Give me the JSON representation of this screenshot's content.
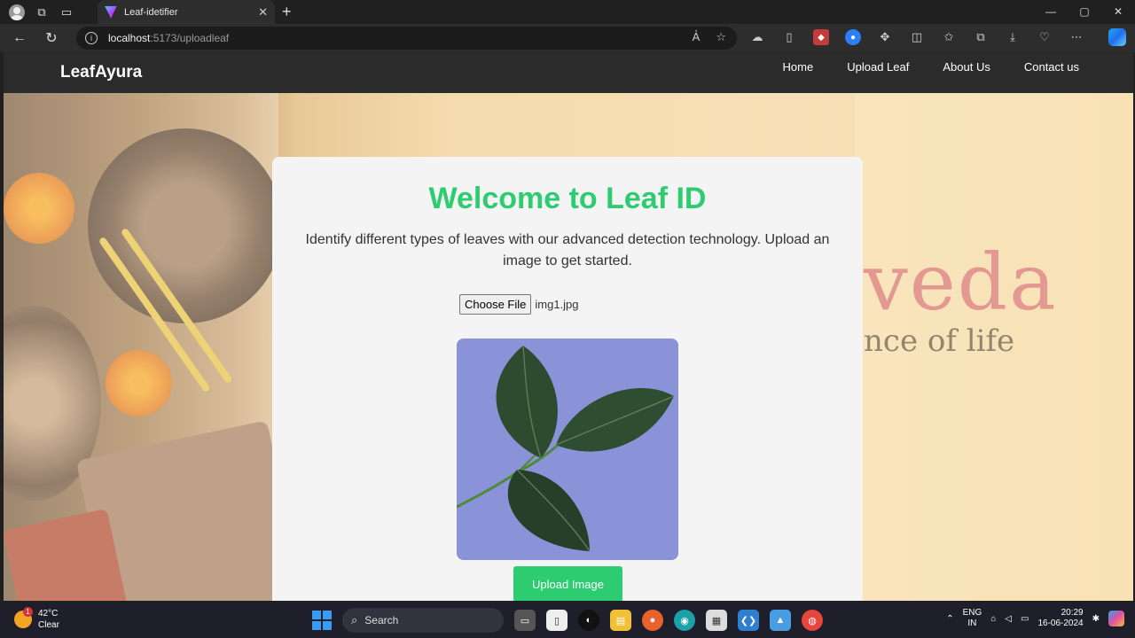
{
  "browser": {
    "tab_title": "Leaf-idetifier",
    "url_host": "localhost",
    "url_path": ":5173/uploadleaf"
  },
  "site": {
    "brand": "LeafAyura",
    "nav": [
      "Home",
      "Upload Leaf",
      "About Us",
      "Contact us"
    ],
    "background_text": "veda",
    "background_subtext": "nce of life"
  },
  "card": {
    "title": "Welcome to Leaf ID",
    "description": "Identify different types of leaves with our advanced detection technology. Upload an image to get started.",
    "choose_file_label": "Choose File",
    "file_name": "img1.jpg",
    "upload_button": "Upload Image"
  },
  "taskbar": {
    "weather_temp": "42°C",
    "weather_desc": "Clear",
    "weather_badge": "1",
    "search_label": "Search",
    "lang_top": "ENG",
    "lang_bottom": "IN",
    "time": "20:29",
    "date": "16-06-2024"
  },
  "colors": {
    "accent": "#2ecc71",
    "navbar": "#2b2b2b",
    "card": "#f4f4f4"
  }
}
